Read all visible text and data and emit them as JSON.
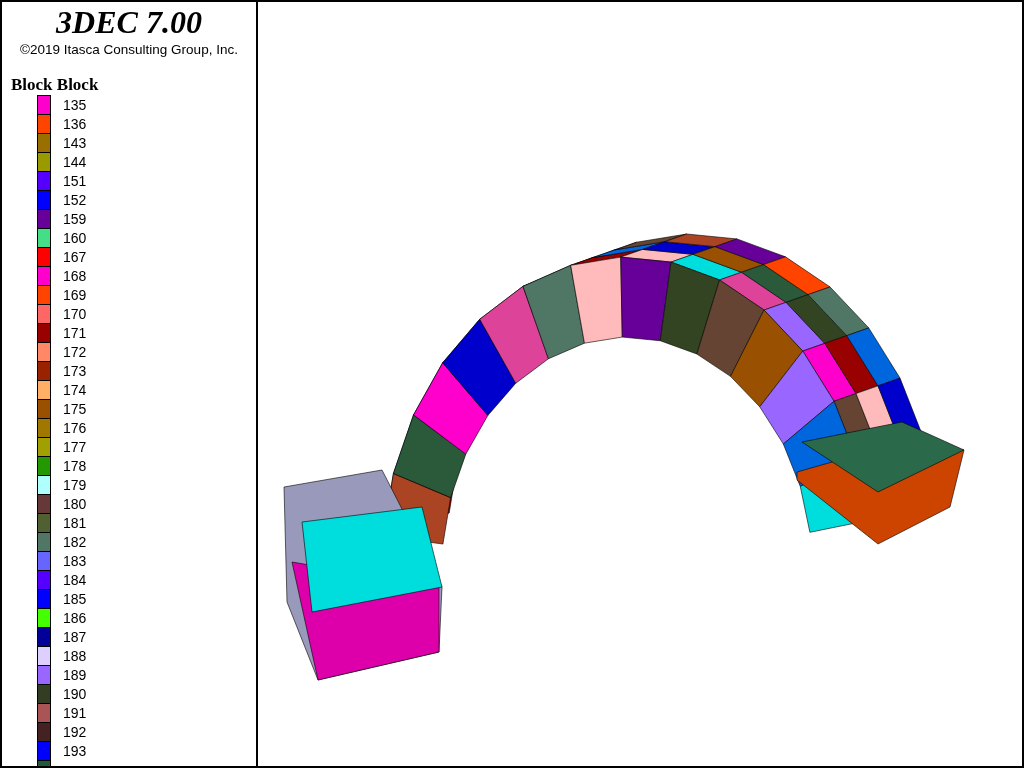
{
  "title": "3DEC 7.00",
  "copyright": "©2019 Itasca Consulting Group, Inc.",
  "legend": {
    "title": "Block Block",
    "items": [
      {
        "label": "135",
        "color": "#ff00cc"
      },
      {
        "label": "136",
        "color": "#ff4400"
      },
      {
        "label": "143",
        "color": "#997000"
      },
      {
        "label": "144",
        "color": "#999900"
      },
      {
        "label": "151",
        "color": "#5500ff"
      },
      {
        "label": "152",
        "color": "#0000ff"
      },
      {
        "label": "159",
        "color": "#660099"
      },
      {
        "label": "160",
        "color": "#44dd88"
      },
      {
        "label": "167",
        "color": "#ff0000"
      },
      {
        "label": "168",
        "color": "#ff00cc"
      },
      {
        "label": "169",
        "color": "#ff4400"
      },
      {
        "label": "170",
        "color": "#ff6666"
      },
      {
        "label": "171",
        "color": "#990000"
      },
      {
        "label": "172",
        "color": "#ff8866"
      },
      {
        "label": "173",
        "color": "#992200"
      },
      {
        "label": "174",
        "color": "#ffb066"
      },
      {
        "label": "175",
        "color": "#995000"
      },
      {
        "label": "176",
        "color": "#a07800"
      },
      {
        "label": "177",
        "color": "#a0a000"
      },
      {
        "label": "178",
        "color": "#229900"
      },
      {
        "label": "179",
        "color": "#b0ffff"
      },
      {
        "label": "180",
        "color": "#663838"
      },
      {
        "label": "181",
        "color": "#506030"
      },
      {
        "label": "182",
        "color": "#507766"
      },
      {
        "label": "183",
        "color": "#6666ff"
      },
      {
        "label": "184",
        "color": "#5500ff"
      },
      {
        "label": "185",
        "color": "#0000ff"
      },
      {
        "label": "186",
        "color": "#44ff00"
      },
      {
        "label": "187",
        "color": "#000099"
      },
      {
        "label": "188",
        "color": "#ddd0ff"
      },
      {
        "label": "189",
        "color": "#9966ff"
      },
      {
        "label": "190",
        "color": "#333d22"
      },
      {
        "label": "191",
        "color": "#aa5555"
      },
      {
        "label": "192",
        "color": "#442222"
      },
      {
        "label": "193",
        "color": "#0000ff"
      },
      {
        "color": "#1e5a3c"
      }
    ]
  }
}
